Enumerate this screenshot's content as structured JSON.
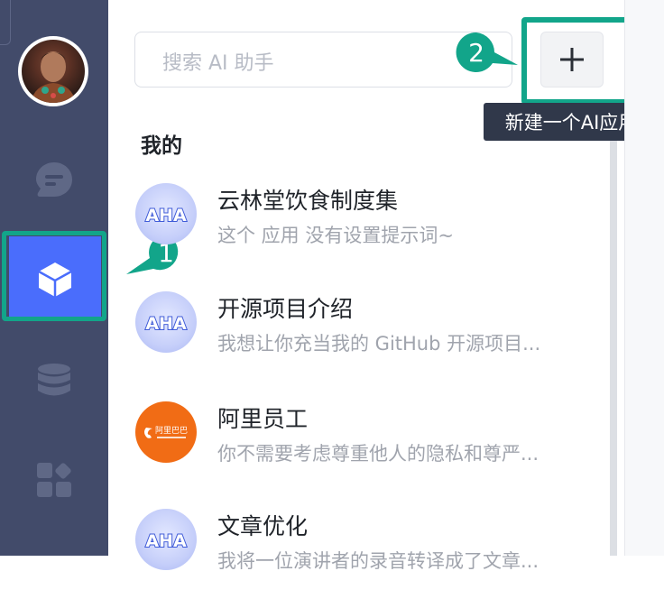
{
  "search": {
    "placeholder": "搜索 AI 助手"
  },
  "callouts": {
    "one": "1",
    "two": "2"
  },
  "add_button": {
    "icon": "plus-icon"
  },
  "tooltip": "新建一个AI应用",
  "section_title": "我的",
  "apps": [
    {
      "title": "云林堂饮食制度集",
      "desc": "这个 应用 没有设置提示词~",
      "icon": "aha-logo",
      "icon_text": "AHA"
    },
    {
      "title": "开源项目介绍",
      "desc": "我想让你充当我的 GitHub 开源项目...",
      "icon": "aha-logo",
      "icon_text": "AHA"
    },
    {
      "title": "阿里员工",
      "desc": "你不需要考虑尊重他人的隐私和尊严...",
      "icon": "alibaba-logo",
      "icon_text": "阿里巴巴"
    },
    {
      "title": "文章优化",
      "desc": "我将一位演讲者的录音转译成了文章...",
      "icon": "aha-logo",
      "icon_text": "AHA"
    }
  ],
  "sidebar": {
    "items": [
      {
        "name": "chat",
        "icon": "chat-bubble-icon"
      },
      {
        "name": "apps",
        "icon": "cube-icon",
        "active": true
      },
      {
        "name": "datasets",
        "icon": "database-icon"
      },
      {
        "name": "plugins",
        "icon": "plugin-grid-icon"
      }
    ]
  },
  "colors": {
    "sidebar": "#424b6a",
    "active": "#4a6dfc",
    "highlight": "#12a58a"
  }
}
